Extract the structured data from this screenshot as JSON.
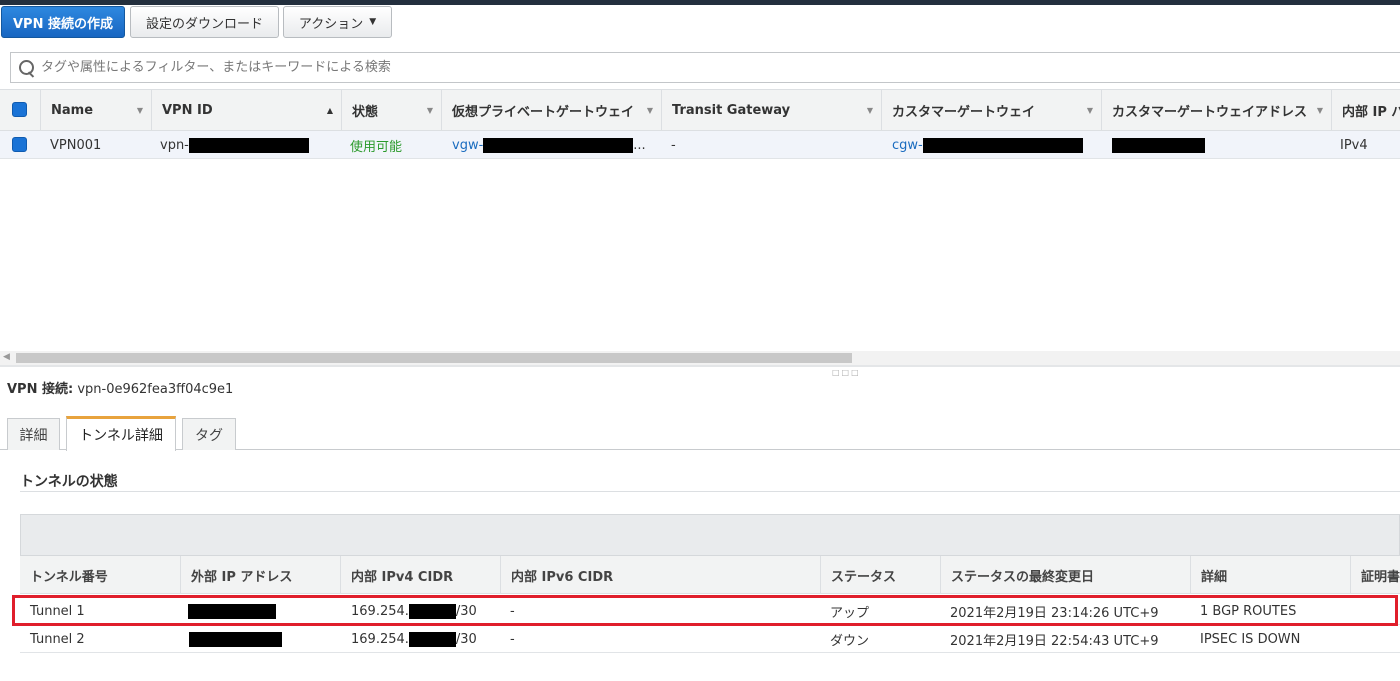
{
  "toolbar": {
    "create_label": "VPN 接続の作成",
    "download_label": "設定のダウンロード",
    "actions_label": "アクション"
  },
  "search": {
    "placeholder": "タグや属性によるフィルター、またはキーワードによる検索"
  },
  "table": {
    "columns": [
      "Name",
      "VPN ID",
      "状態",
      "仮想プライベートゲートウェイ",
      "Transit Gateway",
      "カスタマーゲートウェイ",
      "カスタマーゲートウェイアドレス",
      "内部 IP バ"
    ],
    "row": {
      "name": "VPN001",
      "vpn_id_prefix": "vpn-",
      "state": "使用可能",
      "vgw_prefix": "vgw-",
      "vgw_suffix": "...",
      "transit_gateway": "-",
      "cgw_prefix": "cgw-",
      "inner_ip": "IPv4"
    }
  },
  "detail": {
    "label": "VPN 接続:",
    "vpn_id": "vpn-0e962fea3ff04c9e1",
    "tabs": [
      "詳細",
      "トンネル詳細",
      "タグ"
    ],
    "active_tab": "トンネル詳細",
    "section_title": "トンネルの状態",
    "tunnel_columns": [
      "トンネル番号",
      "外部 IP アドレス",
      "内部 IPv4 CIDR",
      "内部 IPv6 CIDR",
      "ステータス",
      "ステータスの最終変更日",
      "詳細",
      "証明書"
    ],
    "tunnels": [
      {
        "number": "Tunnel 1",
        "cidr_prefix": "169.254.",
        "cidr_suffix": "/30",
        "ipv6": "-",
        "status": "アップ",
        "last_change": "2021年2月19日 23:14:26 UTC+9",
        "details": "1 BGP ROUTES"
      },
      {
        "number": "Tunnel 2",
        "cidr_prefix": "169.254.",
        "cidr_suffix": "/30",
        "ipv6": "-",
        "status": "ダウン",
        "last_change": "2021年2月19日 22:54:43 UTC+9",
        "details": "IPSEC IS DOWN"
      }
    ]
  },
  "colors": {
    "primary": "#1a73d6",
    "status_up": "#2b9a2b",
    "status_down": "#d12f2f",
    "highlight": "#e01e2b",
    "active_tab": "#e8a33d"
  }
}
